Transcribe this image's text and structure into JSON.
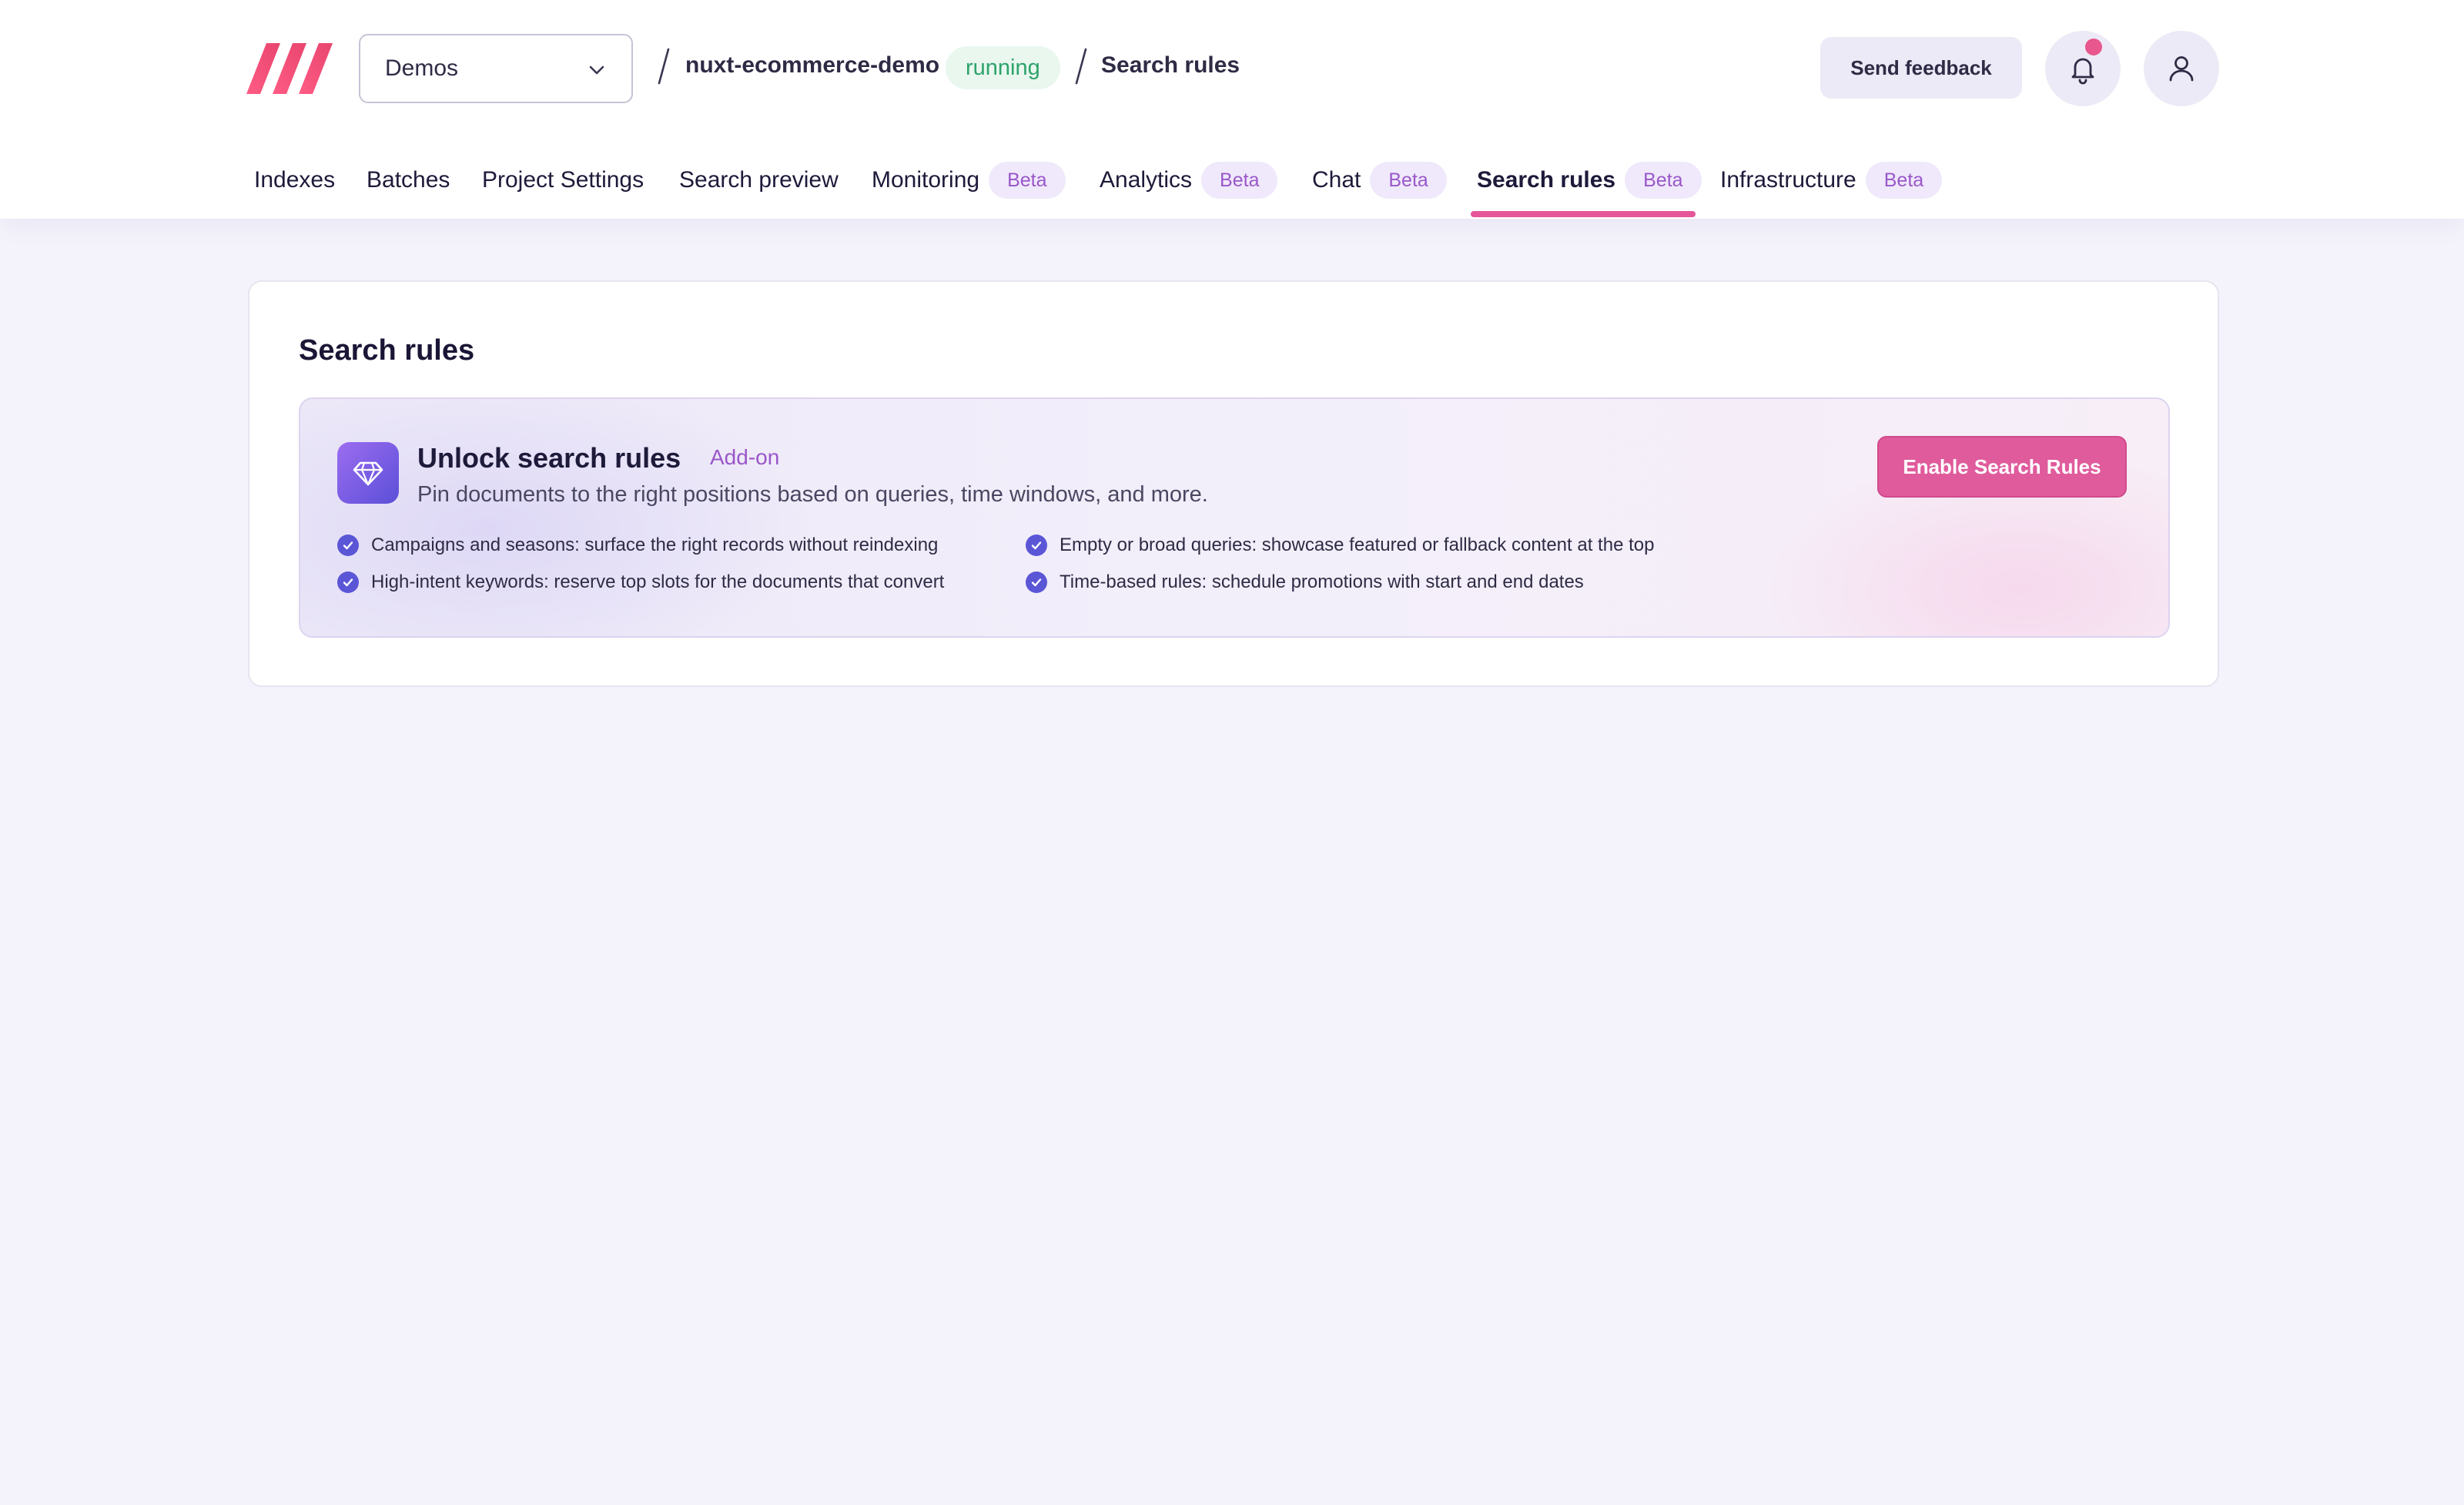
{
  "header": {
    "project_selector": {
      "value": "Demos"
    },
    "breadcrumb": {
      "project": "nuxt-ecommerce-demo",
      "status": "running",
      "page": "Search rules"
    },
    "feedback_label": "Send feedback",
    "icons": {
      "logo": "meilisearch-logo",
      "bell": "bell-icon",
      "user": "user-icon",
      "chevron": "chevron-down-icon"
    },
    "has_notification": true
  },
  "tabs": [
    {
      "label": "Indexes"
    },
    {
      "label": "Batches"
    },
    {
      "label": "Project Settings"
    },
    {
      "label": "Search preview"
    },
    {
      "label": "Monitoring",
      "badge": "Beta"
    },
    {
      "label": "Analytics",
      "badge": "Beta"
    },
    {
      "label": "Chat",
      "badge": "Beta"
    },
    {
      "label": "Search rules",
      "badge": "Beta",
      "active": true
    },
    {
      "label": "Infrastructure",
      "badge": "Beta"
    }
  ],
  "main": {
    "title": "Search rules",
    "promo": {
      "icon": "diamond-icon",
      "title": "Unlock search rules",
      "tag": "Add-on",
      "description": "Pin documents to the right positions based on queries, time windows, and more.",
      "features": [
        "Campaigns and seasons: surface the right records without reindexing",
        "High-intent keywords: reserve top slots for the documents that convert",
        "Empty or broad queries: showcase featured or fallback content at the top",
        "Time-based rules: schedule promotions with start and end dates"
      ],
      "cta_label": "Enable Search Rules"
    }
  },
  "colors": {
    "accent_pink": "#e05b9c",
    "accent_purple": "#5b56d6",
    "running_green": "#2ea36b",
    "beta_purple": "#9a57c9",
    "background": "#f4f3fb"
  }
}
